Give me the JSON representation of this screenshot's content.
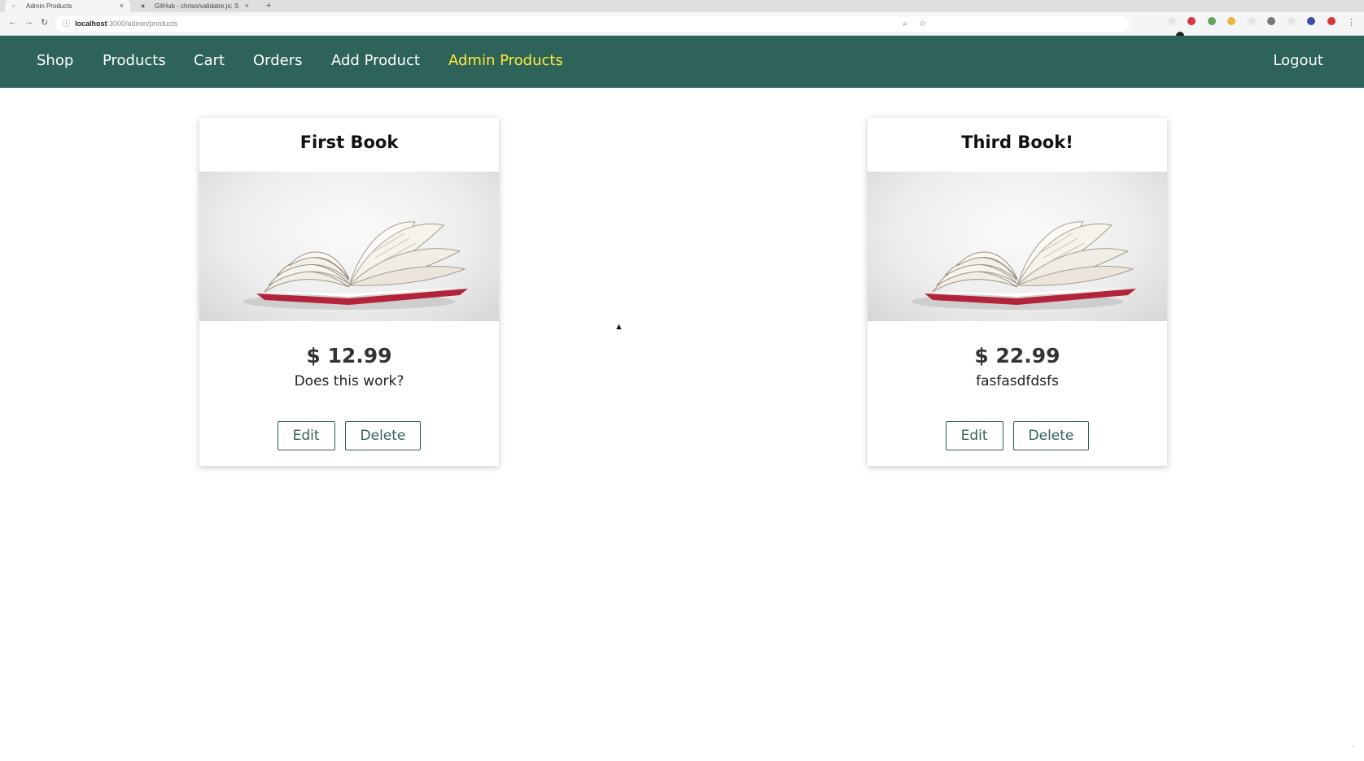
{
  "browser": {
    "tabs": [
      {
        "title": "Admin Products",
        "icon": "page-icon",
        "active": true
      },
      {
        "title": "GitHub - chriso/validator.js: S",
        "icon": "github-icon",
        "active": false
      }
    ],
    "close_glyph": "×",
    "new_tab_glyph": "+",
    "url_host": "localhost",
    "url_path": ":3000/admin/products"
  },
  "nav": {
    "items": [
      "Shop",
      "Products",
      "Cart",
      "Orders",
      "Add Product",
      "Admin Products"
    ],
    "active": "Admin Products",
    "logout": "Logout"
  },
  "products": [
    {
      "title": "First Book",
      "price": "$ 12.99",
      "description": "Does this work?",
      "edit_label": "Edit",
      "delete_label": "Delete"
    },
    {
      "title": "Third Book!",
      "price": "$ 22.99",
      "description": "fasfasdfdsfs",
      "edit_label": "Edit",
      "delete_label": "Delete"
    }
  ],
  "colors": {
    "header_bg": "#2e6359",
    "active_nav": "#ffeb3b",
    "button_border": "#2e6359"
  }
}
